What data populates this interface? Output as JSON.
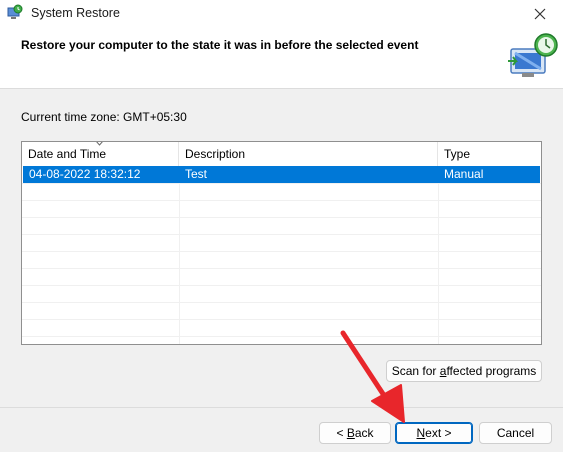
{
  "window": {
    "title": "System Restore"
  },
  "header": {
    "title": "Restore your computer to the state it was in before the selected event"
  },
  "timezone_label": "Current time zone: GMT+05:30",
  "table": {
    "columns": [
      "Date and Time",
      "Description",
      "Type"
    ],
    "rows": [
      {
        "date": "04-08-2022 18:32:12",
        "description": "Test",
        "type": "Manual",
        "selected": true
      }
    ]
  },
  "buttons": {
    "scan": {
      "pre": "Scan for ",
      "accel": "a",
      "post": "ffected programs"
    },
    "back": {
      "pre": "< ",
      "accel": "B",
      "post": "ack"
    },
    "next": {
      "pre": "",
      "accel": "N",
      "post": "ext >"
    },
    "cancel": "Cancel"
  },
  "colors": {
    "selection": "#0078d7",
    "annotation_arrow": "#e8262b",
    "primary_border": "#0067c0"
  }
}
